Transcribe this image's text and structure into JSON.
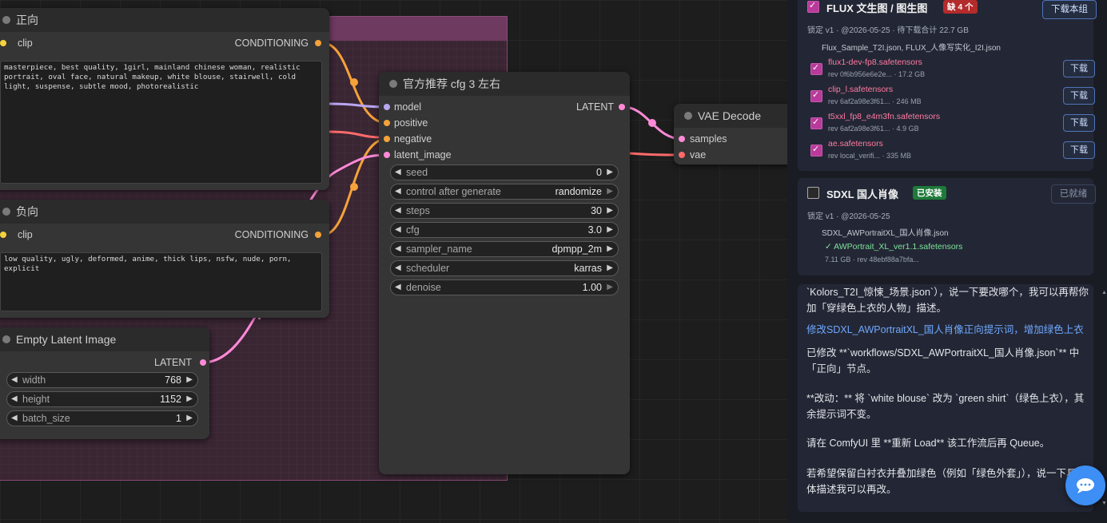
{
  "canvas": {
    "pos_node": {
      "title": "正向",
      "input_clip": "clip",
      "output": "CONDITIONING",
      "text": "masterpiece, best quality, 1girl, mainland chinese woman, realistic portrait, oval face, natural makeup, white blouse, stairwell, cold light, suspense, subtle mood, photorealistic"
    },
    "neg_node": {
      "title": "负向",
      "input_clip": "clip",
      "output": "CONDITIONING",
      "text": "low quality, ugly, deformed, anime, thick lips, nsfw, nude, porn, explicit"
    },
    "latent_node": {
      "title": "Empty Latent Image",
      "output": "LATENT",
      "widgets": [
        {
          "name": "width",
          "value": "768"
        },
        {
          "name": "height",
          "value": "1152"
        },
        {
          "name": "batch_size",
          "value": "1"
        }
      ]
    },
    "ksampler": {
      "title": "官方推荐 cfg 3 左右",
      "inputs": [
        "model",
        "positive",
        "negative",
        "latent_image"
      ],
      "output": "LATENT",
      "widgets": [
        {
          "name": "seed",
          "value": "0"
        },
        {
          "name": "control after generate",
          "value": "randomize"
        },
        {
          "name": "steps",
          "value": "30"
        },
        {
          "name": "cfg",
          "value": "3.0"
        },
        {
          "name": "sampler_name",
          "value": "dpmpp_2m"
        },
        {
          "name": "scheduler",
          "value": "karras"
        },
        {
          "name": "denoise",
          "value": "1.00"
        }
      ]
    },
    "vae_decode": {
      "title": "VAE Decode",
      "inputs": [
        "samples",
        "vae"
      ]
    }
  },
  "panel": {
    "flux": {
      "title": "FLUX 文生图 / 图生图",
      "badge": "缺 4 个",
      "button": "下载本组",
      "meta": "锁定 v1 · @2026-05-25 · 待下载合计 22.7 GB",
      "workflows": "Flux_Sample_T2I.json, FLUX_人像写实化_I2I.json",
      "files": [
        {
          "name": "flux1-dev-fp8.safetensors",
          "meta": "rev 0f6b956e6e2e... · 17.2 GB",
          "button": "下载"
        },
        {
          "name": "clip_l.safetensors",
          "meta": "rev 6af2a98e3f61... · 246 MB",
          "button": "下载"
        },
        {
          "name": "t5xxl_fp8_e4m3fn.safetensors",
          "meta": "rev 6af2a98e3f61... · 4.9 GB",
          "button": "下载"
        },
        {
          "name": "ae.safetensors",
          "meta": "rev local_verifi... · 335 MB",
          "button": "下载"
        }
      ]
    },
    "sdxl": {
      "title": "SDXL 国人肖像",
      "badge": "已安装",
      "button": "已就绪",
      "meta": "锁定 v1 · @2026-05-25",
      "workflows": "SDXL_AWPortraitXL_国人肖像.json",
      "file": "✓ AWPortrait_XL_ver1.1.safetensors",
      "file_meta": "7.11 GB · rev 48ebf88a7bfa..."
    },
    "chat": {
      "line1": "`Kolors_T2I_惊悚_场景.json`），说一下要改哪个，我可以再帮你",
      "line2": "加「穿绿色上衣的人物」描述。",
      "user_msg": "修改SDXL_AWPortraitXL_国人肖像正向提示词，增加绿色上衣",
      "reply1a": "已修改 **`workflows/SDXL_AWPortraitXL_国人肖像.json`** 中",
      "reply1b": "「正向」节点。",
      "reply2a": "**改动：** 将 `white blouse` 改为 `green shirt`（绿色上衣），其",
      "reply2b": "余提示词不变。",
      "reply3": "请在 ComfyUI 里 **重新 Load** 该工作流后再 Queue。",
      "reply4a": "若希望保留白衬衣并叠加绿色（例如「绿色外套」），说一下具",
      "reply4b": "体描述我可以再改。"
    }
  },
  "colors": {
    "clip_slot": "#f5d33a",
    "conditioning": "#f5a23a",
    "latent": "#ff8ad8",
    "model": "#b9a6f0",
    "vae": "#ff6b6b",
    "accent_blue": "#3d8ef5"
  }
}
